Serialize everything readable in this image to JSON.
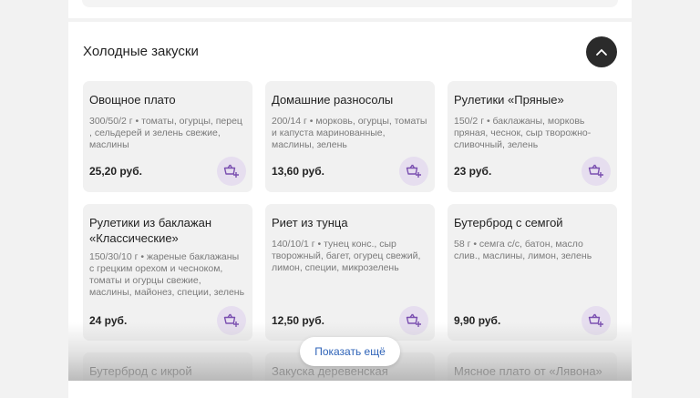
{
  "section": {
    "title": "Холодные закуски",
    "collapse_icon": "chevron-up-icon"
  },
  "cards": [
    {
      "name": "Овощное плато",
      "desc": "300/50/2 г • томаты, огурцы, перец , сельдерей и зелень свежие, маслины",
      "price": "25,20 руб."
    },
    {
      "name": "Домашние разносолы",
      "desc": "200/14 г • морковь, огурцы, томаты и капуста маринованные, маслины, зелень",
      "price": "13,60 руб."
    },
    {
      "name": "Рулетики «Пряные»",
      "desc": "150/2 г • баклажаны, морковь пряная, чеснок, сыр творожно-сливочный, зелень",
      "price": "23 руб."
    },
    {
      "name": "Рулетики из баклажан «Классические»",
      "desc": "150/30/10 г • жареные баклажаны с грецким орехом и чесноком, томаты и огурцы свежие, маслины, майонез, специи, зелень",
      "price": "24 руб."
    },
    {
      "name": "Риет из тунца",
      "desc": "140/10/1 г • тунец конс., сыр творожный, багет, огурец свежий, лимон, специи, микрозелень",
      "price": "12,50 руб."
    },
    {
      "name": "Бутерброд с семгой",
      "desc": "58 г • семга с/с, батон, масло слив., маслины, лимон, зелень",
      "price": "9,90 руб."
    },
    {
      "name": "Бутерброд с икрой"
    },
    {
      "name": "Закуска деревенская"
    },
    {
      "name": "Мясное плато от «Лявона»"
    }
  ],
  "cart_icon": "basket-add-icon",
  "show_more_label": "Показать ещё",
  "colors": {
    "accent": "#7a4fb0",
    "cart_bg": "#e6deef",
    "link": "#2e63b8"
  }
}
